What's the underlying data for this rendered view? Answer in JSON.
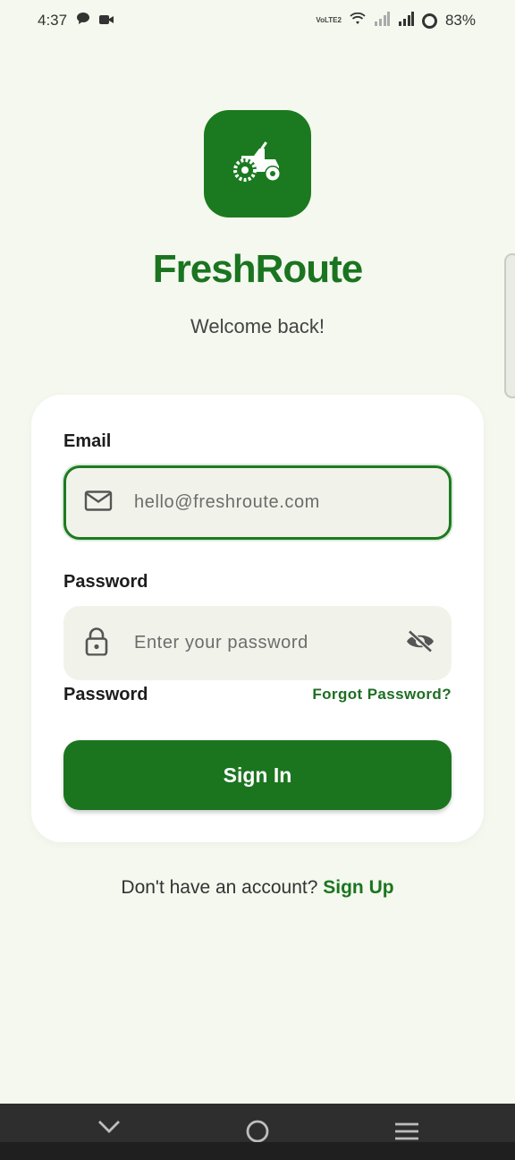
{
  "status_bar": {
    "time": "4:37",
    "network_label": "VoLTE2",
    "battery": "83%",
    "icons": [
      "chat-bubble-icon",
      "video-icon",
      "wifi-icon",
      "signal-icon",
      "battery-ring-icon"
    ]
  },
  "app": {
    "title": "FreshRoute",
    "subtitle": "Welcome back!",
    "logo_icon": "tractor-icon",
    "brand_color": "#1b7a1f"
  },
  "form": {
    "email_label": "Email",
    "email_placeholder": "hello@freshroute.com",
    "password_label": "Password",
    "password_placeholder": "Enter your password",
    "password_label_repeat": "Password",
    "forgot_label": "Forgot Password?",
    "signin_label": "Sign In"
  },
  "footer": {
    "prompt": "Don't have an account?",
    "signup_label": "Sign Up"
  },
  "nav": {
    "items": [
      "back-chevron-icon",
      "home-circle-icon",
      "menu-lines-icon"
    ]
  }
}
